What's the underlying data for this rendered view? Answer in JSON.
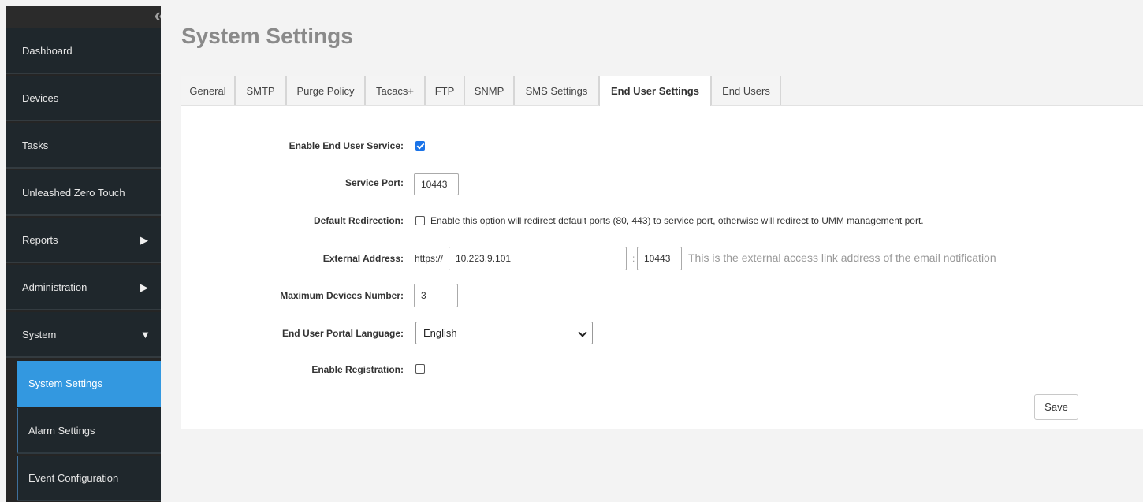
{
  "sidebar": {
    "collapse_icon": "«",
    "items": [
      {
        "label": "Dashboard"
      },
      {
        "label": "Devices"
      },
      {
        "label": "Tasks"
      },
      {
        "label": "Unleashed Zero Touch"
      },
      {
        "label": "Reports",
        "arrow": "▶"
      },
      {
        "label": "Administration",
        "arrow": "▶"
      },
      {
        "label": "System",
        "arrow": "▼"
      }
    ],
    "subitems": [
      {
        "label": "System Settings",
        "active": true
      },
      {
        "label": "Alarm Settings"
      },
      {
        "label": "Event Configuration"
      }
    ]
  },
  "page": {
    "title": "System Settings"
  },
  "tabs": [
    "General",
    "SMTP",
    "Purge Policy",
    "Tacacs+",
    "FTP",
    "SNMP",
    "SMS Settings",
    "End User Settings",
    "End Users"
  ],
  "active_tab": "End User Settings",
  "form": {
    "enable_service": {
      "label": "Enable End User Service:",
      "checked": true
    },
    "service_port": {
      "label": "Service Port:",
      "value": "10443"
    },
    "default_redirection": {
      "label": "Default Redirection:",
      "checked": false,
      "description": "Enable this option will redirect default ports (80, 443) to service port, otherwise will redirect to UMM management port."
    },
    "external_address": {
      "label": "External Address:",
      "prefix": "https://",
      "host": "10.223.9.101",
      "separator": ":",
      "port": "10443",
      "hint": "This is the external access link address of the email notification"
    },
    "max_devices": {
      "label": "Maximum Devices Number:",
      "value": "3"
    },
    "portal_language": {
      "label": "End User Portal Language:",
      "value": "English"
    },
    "enable_registration": {
      "label": "Enable Registration:",
      "checked": false
    },
    "save_label": "Save"
  },
  "colors": {
    "accent": "#3398e0",
    "sidebar_bg": "#1f272c",
    "checkbox_checked": "#1a73e8"
  }
}
